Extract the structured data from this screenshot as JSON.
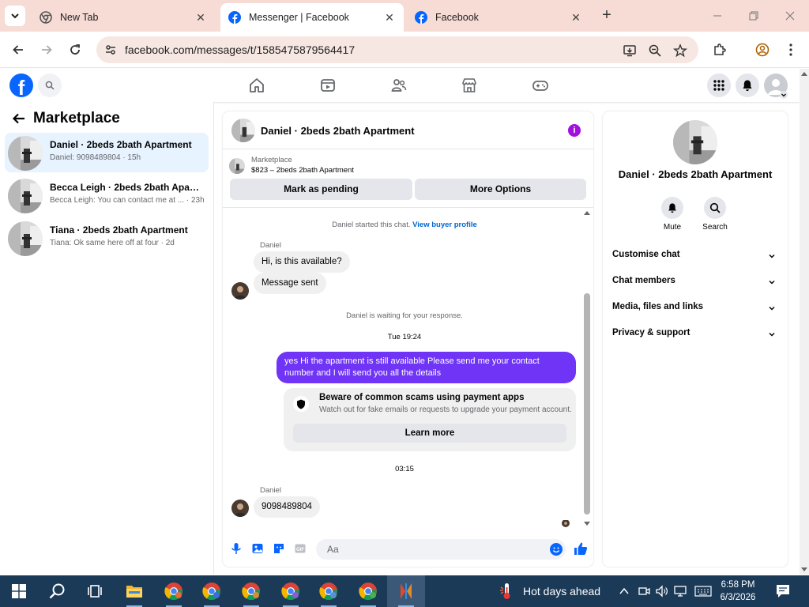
{
  "browser": {
    "tabs": [
      {
        "title": "New Tab"
      },
      {
        "title": "Messenger | Facebook"
      },
      {
        "title": "Facebook"
      }
    ],
    "url": "facebook.com/messages/t/1585475879564417"
  },
  "sidebar": {
    "title": "Marketplace",
    "conversations": [
      {
        "name": "Daniel · 2beds 2bath Apartment",
        "snippet": "Daniel: 9098489804 · 15h"
      },
      {
        "name": "Becca Leigh · 2beds 2bath Apartment",
        "snippet": "Becca Leigh: You can contact me at ... · 23h"
      },
      {
        "name": "Tiana · 2beds 2bath Apartment",
        "snippet": "Tiana: Ok same here off at four · 2d"
      }
    ]
  },
  "chat": {
    "header_name": "Daniel · 2beds 2bath Apartment",
    "listing_label": "Marketplace",
    "listing_price": "$823 – 2beds 2bath Apartment",
    "mark_pending": "Mark as pending",
    "more_options": "More Options",
    "started_text": "Daniel started this chat.",
    "view_profile": "View buyer profile",
    "sender": "Daniel",
    "msg1": "Hi, is this available?",
    "msg2": "Message sent",
    "waiting": "Daniel is waiting for your response.",
    "time1": "Tue 19:24",
    "my_msg": "yes Hi the apartment is still available Please send me your contact number and I will send you all the details",
    "scam_title": "Beware of common scams using payment apps",
    "scam_sub": "Watch out for fake emails or requests to upgrade your payment account.",
    "learn_more": "Learn more",
    "time2": "03:15",
    "msg3": "9098489804",
    "compose_placeholder": "Aa"
  },
  "details": {
    "name": "Daniel · 2beds 2bath Apartment",
    "mute": "Mute",
    "search": "Search",
    "sections": [
      "Customise chat",
      "Chat members",
      "Media, files and links",
      "Privacy & support"
    ]
  },
  "taskbar": {
    "weather": "Hot days ahead",
    "time": "6:58 PM",
    "date": "6/3/2026"
  },
  "colors": {
    "fb_blue": "#0866ff",
    "my_bubble": "#6f34f5",
    "info_purple": "#a20fde",
    "selected_row": "#e7f3ff"
  }
}
